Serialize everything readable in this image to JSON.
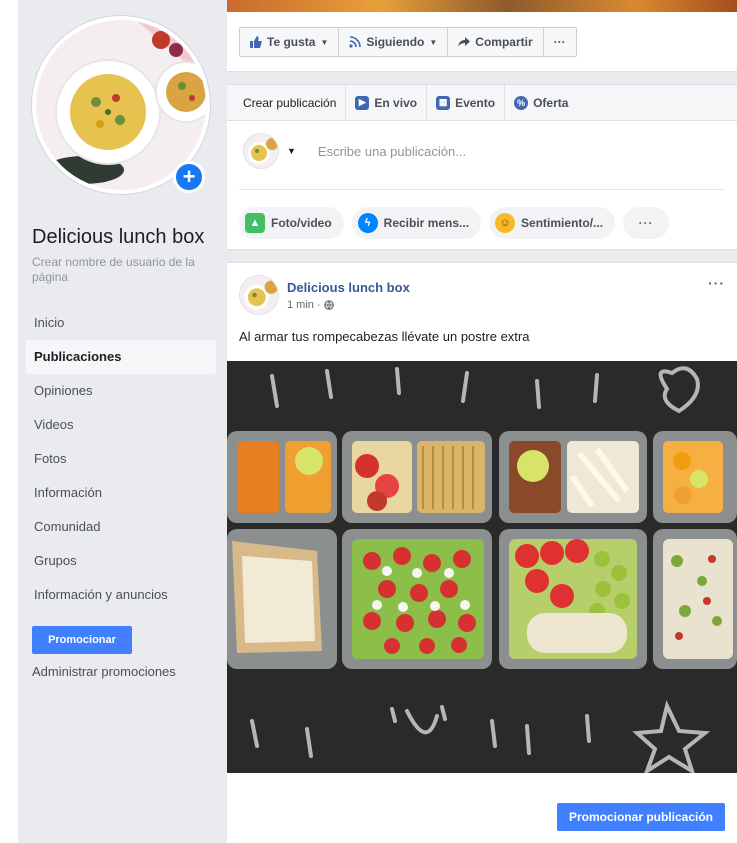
{
  "page": {
    "name": "Delicious lunch box",
    "username_hint": "Crear nombre de usuario de la página"
  },
  "sidebar": {
    "items": [
      {
        "label": "Inicio",
        "active": false
      },
      {
        "label": "Publicaciones",
        "active": true
      },
      {
        "label": "Opiniones",
        "active": false
      },
      {
        "label": "Videos",
        "active": false
      },
      {
        "label": "Fotos",
        "active": false
      },
      {
        "label": "Información",
        "active": false
      },
      {
        "label": "Comunidad",
        "active": false
      },
      {
        "label": "Grupos",
        "active": false
      },
      {
        "label": "Información y anuncios",
        "active": false
      }
    ],
    "promote_label": "Promocionar",
    "admin_promotions_label": "Administrar promociones"
  },
  "actions": {
    "like_label": "Te gusta",
    "following_label": "Siguiendo",
    "share_label": "Compartir",
    "more_label": "···"
  },
  "composer": {
    "create_label": "Crear publicación",
    "live_label": "En vivo",
    "event_label": "Evento",
    "offer_label": "Oferta",
    "placeholder": "Escribe una publicación...",
    "chips": {
      "photo_label": "Foto/video",
      "message_label": "Recibir mens...",
      "feeling_label": "Sentimiento/...",
      "more_label": "···"
    }
  },
  "post": {
    "author": "Delicious lunch box",
    "time": "1 min ·",
    "text": "Al armar tus rompecabezas llévate un postre extra",
    "more_label": "···",
    "promote_label": "Promocionar publicación"
  },
  "colors": {
    "brand_blue": "#4080ff",
    "link_blue": "#385898",
    "sidebar_bg": "#e9ebee"
  }
}
